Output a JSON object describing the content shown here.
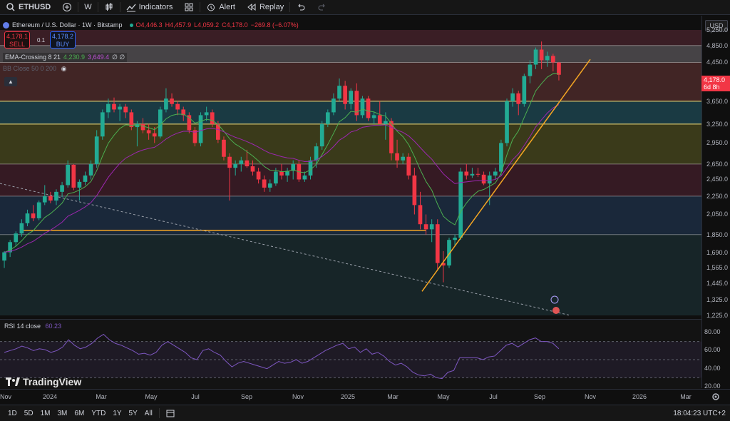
{
  "toolbar": {
    "symbol": "ETHUSD",
    "interval": "W",
    "indicators_label": "Indicators",
    "alert_label": "Alert",
    "replay_label": "Replay"
  },
  "legend": {
    "title": "Ethereum / U.S. Dollar · 1W · Bitstamp",
    "o": "O4,446.3",
    "h": "H4,457.9",
    "l": "L4,059.2",
    "c": "C4,178.0",
    "change": "−269.8 (−6.07%)",
    "sell_price": "4,178.1",
    "sell_label": "SELL",
    "spread": "0.1",
    "buy_price": "4,178.2",
    "buy_label": "BUY",
    "ema_name": "EMA-Crossing 8 21",
    "ema_fast": "4,230.9",
    "ema_slow": "3,649.4",
    "ema_extra": "∅ ∅",
    "hidden_indicator": "BB Close 50 0 200"
  },
  "price_axis": {
    "currency": "USD",
    "current_price": "4,178.0",
    "countdown": "6d 8h",
    "labels": [
      "5,250.0",
      "4,850.0",
      "4,450.0",
      "3,650.0",
      "3,250.0",
      "2,950.0",
      "2,650.0",
      "2,450.0",
      "2,250.0",
      "2,050.0",
      "1,850.0",
      "1,690.0",
      "1,565.0",
      "1,445.0",
      "1,325.0",
      "1,225.0"
    ]
  },
  "rsi": {
    "title": "RSI 14 close",
    "value": "60.23",
    "labels": [
      "80.00",
      "60.00",
      "40.00",
      "20.00"
    ]
  },
  "time_axis": {
    "labels": [
      "Nov",
      "2024",
      "Mar",
      "May",
      "Jul",
      "Sep",
      "Nov",
      "2025",
      "Mar",
      "May",
      "Jul",
      "Sep",
      "Nov",
      "2026",
      "Mar"
    ]
  },
  "bottom_bar": {
    "ranges": [
      "1D",
      "5D",
      "1M",
      "3M",
      "6M",
      "YTD",
      "1Y",
      "5Y",
      "All"
    ],
    "clock": "18:04:23 UTC+2"
  },
  "brand": {
    "name": "TradingView"
  },
  "colors": {
    "up": "#22ab94",
    "down": "#f23645",
    "trendline": "#f5a623",
    "ema_fast": "#4caf50",
    "ema_slow": "#9c27b0",
    "rsi": "#7e57c2"
  },
  "chart_data": {
    "type": "candlestick",
    "title": "Ethereum / U.S. Dollar · 1W · Bitstamp",
    "ylim": [
      1225,
      5250
    ],
    "xlabel": "",
    "ylabel": "",
    "log_scale": true,
    "candles": [
      {
        "o": 1620,
        "h": 1700,
        "l": 1560,
        "c": 1690
      },
      {
        "o": 1690,
        "h": 1800,
        "l": 1650,
        "c": 1780
      },
      {
        "o": 1780,
        "h": 1880,
        "l": 1740,
        "c": 1860
      },
      {
        "o": 1860,
        "h": 2000,
        "l": 1830,
        "c": 1960
      },
      {
        "o": 1960,
        "h": 2100,
        "l": 1930,
        "c": 2060
      },
      {
        "o": 2060,
        "h": 2150,
        "l": 1980,
        "c": 2010
      },
      {
        "o": 2010,
        "h": 2200,
        "l": 1990,
        "c": 2180
      },
      {
        "o": 2180,
        "h": 2380,
        "l": 2150,
        "c": 2250
      },
      {
        "o": 2250,
        "h": 2300,
        "l": 2170,
        "c": 2200
      },
      {
        "o": 2200,
        "h": 2330,
        "l": 2150,
        "c": 2300
      },
      {
        "o": 2300,
        "h": 2420,
        "l": 2240,
        "c": 2380
      },
      {
        "o": 2380,
        "h": 2700,
        "l": 2350,
        "c": 2640
      },
      {
        "o": 2640,
        "h": 2650,
        "l": 2320,
        "c": 2350
      },
      {
        "o": 2350,
        "h": 2450,
        "l": 2200,
        "c": 2420
      },
      {
        "o": 2420,
        "h": 2550,
        "l": 2380,
        "c": 2500
      },
      {
        "o": 2500,
        "h": 2700,
        "l": 2450,
        "c": 2650
      },
      {
        "o": 2650,
        "h": 3150,
        "l": 2600,
        "c": 3050
      },
      {
        "o": 3050,
        "h": 3500,
        "l": 3000,
        "c": 3450
      },
      {
        "o": 3450,
        "h": 3700,
        "l": 3350,
        "c": 3600
      },
      {
        "o": 3600,
        "h": 3720,
        "l": 3450,
        "c": 3500
      },
      {
        "o": 3500,
        "h": 3600,
        "l": 3300,
        "c": 3550
      },
      {
        "o": 3550,
        "h": 3600,
        "l": 3350,
        "c": 3450
      },
      {
        "o": 3450,
        "h": 3500,
        "l": 3150,
        "c": 3200
      },
      {
        "o": 3200,
        "h": 3300,
        "l": 2900,
        "c": 3250
      },
      {
        "o": 3250,
        "h": 3350,
        "l": 3100,
        "c": 3150
      },
      {
        "o": 3150,
        "h": 3250,
        "l": 3000,
        "c": 3100
      },
      {
        "o": 3100,
        "h": 3200,
        "l": 2950,
        "c": 3050
      },
      {
        "o": 3050,
        "h": 3550,
        "l": 3020,
        "c": 3500
      },
      {
        "o": 3500,
        "h": 3900,
        "l": 3450,
        "c": 3700
      },
      {
        "o": 3700,
        "h": 3800,
        "l": 3550,
        "c": 3600
      },
      {
        "o": 3600,
        "h": 3650,
        "l": 3400,
        "c": 3500
      },
      {
        "o": 3500,
        "h": 3550,
        "l": 3300,
        "c": 3400
      },
      {
        "o": 3400,
        "h": 3450,
        "l": 3100,
        "c": 3150
      },
      {
        "o": 3150,
        "h": 3200,
        "l": 2900,
        "c": 2950
      },
      {
        "o": 2950,
        "h": 3450,
        "l": 2900,
        "c": 3400
      },
      {
        "o": 3400,
        "h": 3550,
        "l": 3300,
        "c": 3450
      },
      {
        "o": 3450,
        "h": 3500,
        "l": 3200,
        "c": 3250
      },
      {
        "o": 3250,
        "h": 3300,
        "l": 2950,
        "c": 3000
      },
      {
        "o": 3000,
        "h": 3050,
        "l": 2700,
        "c": 2750
      },
      {
        "o": 2750,
        "h": 2800,
        "l": 2200,
        "c": 2600
      },
      {
        "o": 2600,
        "h": 2700,
        "l": 2500,
        "c": 2650
      },
      {
        "o": 2650,
        "h": 2750,
        "l": 2550,
        "c": 2700
      },
      {
        "o": 2700,
        "h": 2850,
        "l": 2600,
        "c": 2620
      },
      {
        "o": 2620,
        "h": 2700,
        "l": 2500,
        "c": 2550
      },
      {
        "o": 2550,
        "h": 2600,
        "l": 2400,
        "c": 2450
      },
      {
        "o": 2450,
        "h": 2500,
        "l": 2300,
        "c": 2350
      },
      {
        "o": 2350,
        "h": 2450,
        "l": 2300,
        "c": 2400
      },
      {
        "o": 2400,
        "h": 2600,
        "l": 2370,
        "c": 2550
      },
      {
        "o": 2550,
        "h": 2650,
        "l": 2450,
        "c": 2500
      },
      {
        "o": 2500,
        "h": 2600,
        "l": 2420,
        "c": 2560
      },
      {
        "o": 2560,
        "h": 2700,
        "l": 2450,
        "c": 2650
      },
      {
        "o": 2650,
        "h": 2700,
        "l": 2420,
        "c": 2450
      },
      {
        "o": 2450,
        "h": 2550,
        "l": 2420,
        "c": 2500
      },
      {
        "o": 2500,
        "h": 2750,
        "l": 2450,
        "c": 2700
      },
      {
        "o": 2700,
        "h": 2950,
        "l": 2600,
        "c": 2900
      },
      {
        "o": 2900,
        "h": 3300,
        "l": 2850,
        "c": 3250
      },
      {
        "o": 3250,
        "h": 3500,
        "l": 3200,
        "c": 3450
      },
      {
        "o": 3450,
        "h": 3800,
        "l": 3400,
        "c": 3700
      },
      {
        "o": 3700,
        "h": 4100,
        "l": 3650,
        "c": 3950
      },
      {
        "o": 3950,
        "h": 4050,
        "l": 3500,
        "c": 3600
      },
      {
        "o": 3600,
        "h": 3900,
        "l": 3500,
        "c": 3850
      },
      {
        "o": 3850,
        "h": 4000,
        "l": 3300,
        "c": 3400
      },
      {
        "o": 3400,
        "h": 3750,
        "l": 3350,
        "c": 3700
      },
      {
        "o": 3700,
        "h": 3750,
        "l": 3300,
        "c": 3350
      },
      {
        "o": 3350,
        "h": 3450,
        "l": 3250,
        "c": 3400
      },
      {
        "o": 3400,
        "h": 3650,
        "l": 3300,
        "c": 3250
      },
      {
        "o": 3250,
        "h": 3450,
        "l": 3000,
        "c": 3300
      },
      {
        "o": 3300,
        "h": 3350,
        "l": 2700,
        "c": 2800
      },
      {
        "o": 2800,
        "h": 3000,
        "l": 2600,
        "c": 2700
      },
      {
        "o": 2700,
        "h": 2800,
        "l": 2650,
        "c": 2750
      },
      {
        "o": 2750,
        "h": 2800,
        "l": 2450,
        "c": 2500
      },
      {
        "o": 2500,
        "h": 2600,
        "l": 2050,
        "c": 2150
      },
      {
        "o": 2150,
        "h": 2300,
        "l": 1900,
        "c": 1950
      },
      {
        "o": 1950,
        "h": 2050,
        "l": 1850,
        "c": 1900
      },
      {
        "o": 1900,
        "h": 2000,
        "l": 1780,
        "c": 1950
      },
      {
        "o": 1950,
        "h": 2000,
        "l": 1550,
        "c": 1600
      },
      {
        "o": 1600,
        "h": 1700,
        "l": 1450,
        "c": 1580
      },
      {
        "o": 1580,
        "h": 1820,
        "l": 1560,
        "c": 1800
      },
      {
        "o": 1800,
        "h": 1850,
        "l": 1750,
        "c": 1820
      },
      {
        "o": 1820,
        "h": 2600,
        "l": 1800,
        "c": 2550
      },
      {
        "o": 2550,
        "h": 2650,
        "l": 2450,
        "c": 2500
      },
      {
        "o": 2500,
        "h": 2600,
        "l": 2470,
        "c": 2520
      },
      {
        "o": 2520,
        "h": 2600,
        "l": 2480,
        "c": 2510
      },
      {
        "o": 2510,
        "h": 2550,
        "l": 2380,
        "c": 2400
      },
      {
        "o": 2400,
        "h": 2550,
        "l": 2150,
        "c": 2500
      },
      {
        "o": 2500,
        "h": 2600,
        "l": 2450,
        "c": 2550
      },
      {
        "o": 2550,
        "h": 3000,
        "l": 2500,
        "c": 2950
      },
      {
        "o": 2950,
        "h": 3700,
        "l": 2900,
        "c": 3650
      },
      {
        "o": 3650,
        "h": 3900,
        "l": 3550,
        "c": 3800
      },
      {
        "o": 3800,
        "h": 3850,
        "l": 3400,
        "c": 3600
      },
      {
        "o": 3600,
        "h": 4200,
        "l": 3550,
        "c": 4150
      },
      {
        "o": 4150,
        "h": 4500,
        "l": 4000,
        "c": 4400
      },
      {
        "o": 4400,
        "h": 4800,
        "l": 4300,
        "c": 4750
      },
      {
        "o": 4750,
        "h": 4950,
        "l": 4300,
        "c": 4500
      },
      {
        "o": 4500,
        "h": 4700,
        "l": 4350,
        "c": 4600
      },
      {
        "o": 4600,
        "h": 4650,
        "l": 4250,
        "c": 4450
      },
      {
        "o": 4446.3,
        "h": 4457.9,
        "l": 4059.2,
        "c": 4178.0
      }
    ],
    "horizontal_levels": [
      4850,
      4450,
      3650,
      3250,
      2650,
      2250,
      1850
    ],
    "rsi_values": [
      58,
      60,
      62,
      65,
      63,
      60,
      62,
      61,
      58,
      60,
      64,
      72,
      66,
      62,
      64,
      68,
      74,
      78,
      72,
      68,
      66,
      63,
      60,
      56,
      57,
      55,
      58,
      66,
      70,
      66,
      62,
      58,
      52,
      50,
      60,
      62,
      58,
      55,
      48,
      42,
      46,
      48,
      46,
      44,
      42,
      40,
      44,
      48,
      46,
      47,
      50,
      46,
      48,
      52,
      56,
      60,
      63,
      66,
      68,
      62,
      64,
      58,
      62,
      56,
      58,
      54,
      48,
      44,
      46,
      42,
      36,
      33,
      32,
      34,
      30,
      29,
      36,
      38,
      52,
      52,
      52,
      52,
      50,
      53,
      54,
      60,
      66,
      68,
      64,
      68,
      72,
      74,
      70,
      70,
      68,
      62
    ]
  }
}
